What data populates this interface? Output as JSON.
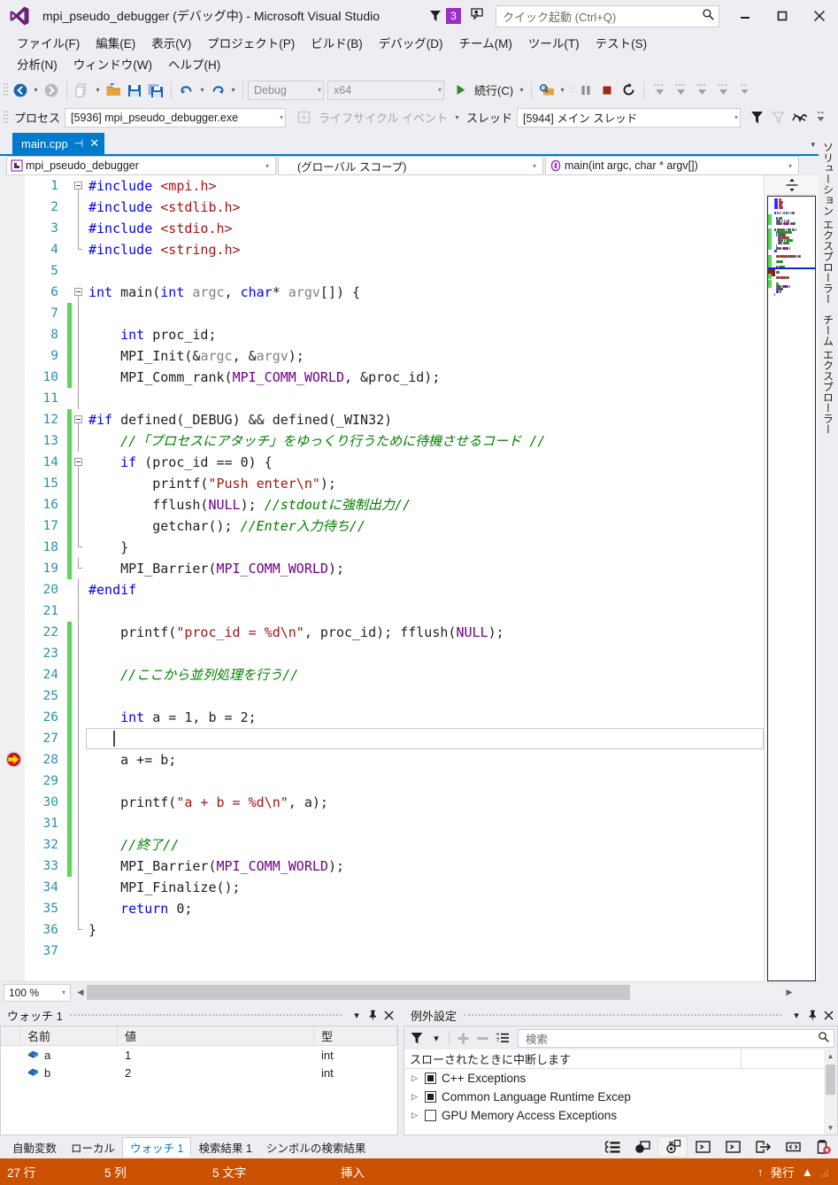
{
  "window": {
    "title": "mpi_pseudo_debugger (デバッグ中) - Microsoft Visual Studio",
    "notification_count": "3",
    "quick_launch_placeholder": "クイック起動 (Ctrl+Q)",
    "minimize_label": "—",
    "maximize_label": "❐",
    "close_label": "✕"
  },
  "menu": {
    "row1": [
      {
        "label": "ファイル(F)"
      },
      {
        "label": "編集(E)"
      },
      {
        "label": "表示(V)"
      },
      {
        "label": "プロジェクト(P)"
      },
      {
        "label": "ビルド(B)"
      },
      {
        "label": "デバッグ(D)"
      },
      {
        "label": "チーム(M)"
      },
      {
        "label": "ツール(T)"
      },
      {
        "label": "テスト(S)"
      }
    ],
    "row2": [
      {
        "label": "分析(N)"
      },
      {
        "label": "ウィンドウ(W)"
      },
      {
        "label": "ヘルプ(H)"
      }
    ]
  },
  "toolbar_standard": {
    "config_value": "Debug",
    "platform_value": "x64",
    "continue_label": "続行(C)"
  },
  "toolbar_debug": {
    "process_label": "プロセス",
    "process_value": "[5936] mpi_pseudo_debugger.exe",
    "lifecycle_label": "ライフサイクル イベント",
    "thread_label": "スレッド",
    "thread_value": "[5944] メイン スレッド"
  },
  "document_tab": {
    "name": "main.cpp",
    "pin_glyph": "⊣",
    "close_glyph": "✕"
  },
  "navbar": {
    "project": "mpi_pseudo_debugger",
    "scope": "(グローバル スコープ)",
    "member": "main(int argc, char * argv[])"
  },
  "editor": {
    "zoom": "100 %",
    "lines": [
      {
        "n": "1",
        "changed": false,
        "outline": "start",
        "tokens": [
          {
            "t": "#include ",
            "c": "pp"
          },
          {
            "t": "<mpi.h>",
            "c": "str"
          }
        ]
      },
      {
        "n": "2",
        "changed": false,
        "outline": "line",
        "tokens": [
          {
            "t": "#include ",
            "c": "pp"
          },
          {
            "t": "<stdlib.h>",
            "c": "str"
          }
        ]
      },
      {
        "n": "3",
        "changed": false,
        "outline": "line",
        "tokens": [
          {
            "t": "#include ",
            "c": "pp"
          },
          {
            "t": "<stdio.h>",
            "c": "str"
          }
        ]
      },
      {
        "n": "4",
        "changed": false,
        "outline": "end",
        "tokens": [
          {
            "t": "#include ",
            "c": "pp"
          },
          {
            "t": "<string.h>",
            "c": "str"
          }
        ]
      },
      {
        "n": "5",
        "changed": false,
        "outline": "",
        "tokens": []
      },
      {
        "n": "6",
        "changed": false,
        "outline": "start",
        "tokens": [
          {
            "t": "int",
            "c": "k"
          },
          {
            "t": " main(",
            "c": "op"
          },
          {
            "t": "int",
            "c": "k"
          },
          {
            "t": " ",
            "c": "op"
          },
          {
            "t": "argc",
            "c": "pa"
          },
          {
            "t": ", ",
            "c": "op"
          },
          {
            "t": "char",
            "c": "k"
          },
          {
            "t": "* ",
            "c": "op"
          },
          {
            "t": "argv",
            "c": "pa"
          },
          {
            "t": "[]) {",
            "c": "op"
          }
        ]
      },
      {
        "n": "7",
        "changed": true,
        "outline": "line",
        "tokens": []
      },
      {
        "n": "8",
        "changed": true,
        "outline": "line",
        "tokens": [
          {
            "t": "    ",
            "c": "op"
          },
          {
            "t": "int",
            "c": "k"
          },
          {
            "t": " proc_id;",
            "c": "op"
          }
        ]
      },
      {
        "n": "9",
        "changed": true,
        "outline": "line",
        "tokens": [
          {
            "t": "    MPI_Init(&",
            "c": "op"
          },
          {
            "t": "argc",
            "c": "pa"
          },
          {
            "t": ", &",
            "c": "op"
          },
          {
            "t": "argv",
            "c": "pa"
          },
          {
            "t": ");",
            "c": "op"
          }
        ]
      },
      {
        "n": "10",
        "changed": true,
        "outline": "line",
        "tokens": [
          {
            "t": "    MPI_Comm_rank(",
            "c": "op"
          },
          {
            "t": "MPI_COMM_WORLD",
            "c": "mac"
          },
          {
            "t": ", &proc_id);",
            "c": "op"
          }
        ]
      },
      {
        "n": "11",
        "changed": false,
        "outline": "line",
        "tokens": []
      },
      {
        "n": "12",
        "changed": true,
        "outline": "start",
        "tokens": [
          {
            "t": "#if",
            "c": "pp"
          },
          {
            "t": " defined(",
            "c": "op"
          },
          {
            "t": "_DEBUG",
            "c": "op"
          },
          {
            "t": ") ",
            "c": "op"
          },
          {
            "t": "&&",
            "c": "op"
          },
          {
            "t": " defined(",
            "c": "op"
          },
          {
            "t": "_WIN32",
            "c": "op"
          },
          {
            "t": ")",
            "c": "op"
          }
        ]
      },
      {
        "n": "13",
        "changed": true,
        "outline": "line",
        "tokens": [
          {
            "t": "    //「プロセスにアタッチ」をゆっくり行うために待機させるコード //",
            "c": "cm"
          }
        ]
      },
      {
        "n": "14",
        "changed": true,
        "outline": "substart",
        "tokens": [
          {
            "t": "    ",
            "c": "op"
          },
          {
            "t": "if",
            "c": "k"
          },
          {
            "t": " (proc_id == 0) {",
            "c": "op"
          }
        ]
      },
      {
        "n": "15",
        "changed": true,
        "outline": "line",
        "tokens": [
          {
            "t": "        printf(",
            "c": "op"
          },
          {
            "t": "\"Push enter\\n\"",
            "c": "str"
          },
          {
            "t": ");",
            "c": "op"
          }
        ]
      },
      {
        "n": "16",
        "changed": true,
        "outline": "line",
        "tokens": [
          {
            "t": "        fflush(",
            "c": "op"
          },
          {
            "t": "NULL",
            "c": "mac"
          },
          {
            "t": "); ",
            "c": "op"
          },
          {
            "t": "//stdoutに強制出力//",
            "c": "cm"
          }
        ]
      },
      {
        "n": "17",
        "changed": true,
        "outline": "line",
        "tokens": [
          {
            "t": "        getchar(); ",
            "c": "op"
          },
          {
            "t": "//Enter入力待ち//",
            "c": "cm"
          }
        ]
      },
      {
        "n": "18",
        "changed": true,
        "outline": "subend",
        "tokens": [
          {
            "t": "    }",
            "c": "op"
          }
        ]
      },
      {
        "n": "19",
        "changed": true,
        "outline": "end",
        "tokens": [
          {
            "t": "    MPI_Barrier(",
            "c": "op"
          },
          {
            "t": "MPI_COMM_WORLD",
            "c": "mac"
          },
          {
            "t": ");",
            "c": "op"
          }
        ]
      },
      {
        "n": "20",
        "changed": false,
        "outline": "line",
        "tokens": [
          {
            "t": "#endif",
            "c": "pp"
          }
        ]
      },
      {
        "n": "21",
        "changed": false,
        "outline": "line",
        "tokens": []
      },
      {
        "n": "22",
        "changed": true,
        "outline": "line",
        "tokens": [
          {
            "t": "    printf(",
            "c": "op"
          },
          {
            "t": "\"proc_id = %d\\n\"",
            "c": "str"
          },
          {
            "t": ", proc_id); fflush(",
            "c": "op"
          },
          {
            "t": "NULL",
            "c": "mac"
          },
          {
            "t": ");",
            "c": "op"
          }
        ]
      },
      {
        "n": "23",
        "changed": true,
        "outline": "line",
        "tokens": []
      },
      {
        "n": "24",
        "changed": true,
        "outline": "line",
        "tokens": [
          {
            "t": "    //ここから並列処理を行う//",
            "c": "cm"
          }
        ]
      },
      {
        "n": "25",
        "changed": true,
        "outline": "line",
        "tokens": []
      },
      {
        "n": "26",
        "changed": true,
        "outline": "line",
        "tokens": [
          {
            "t": "    ",
            "c": "op"
          },
          {
            "t": "int",
            "c": "k"
          },
          {
            "t": " a = 1, b = 2;",
            "c": "op"
          }
        ]
      },
      {
        "n": "27",
        "changed": true,
        "outline": "line",
        "current": true,
        "tokens": []
      },
      {
        "n": "28",
        "changed": true,
        "outline": "line",
        "exec": true,
        "tokens": [
          {
            "t": "    a += b;",
            "c": "op"
          }
        ]
      },
      {
        "n": "29",
        "changed": true,
        "outline": "line",
        "tokens": []
      },
      {
        "n": "30",
        "changed": true,
        "outline": "line",
        "tokens": [
          {
            "t": "    printf(",
            "c": "op"
          },
          {
            "t": "\"a + b = %d\\n\"",
            "c": "str"
          },
          {
            "t": ", a);",
            "c": "op"
          }
        ]
      },
      {
        "n": "31",
        "changed": true,
        "outline": "line",
        "tokens": []
      },
      {
        "n": "32",
        "changed": true,
        "outline": "line",
        "tokens": [
          {
            "t": "    //終了//",
            "c": "cm"
          }
        ]
      },
      {
        "n": "33",
        "changed": true,
        "outline": "line",
        "tokens": [
          {
            "t": "    MPI_Barrier(",
            "c": "op"
          },
          {
            "t": "MPI_COMM_WORLD",
            "c": "mac"
          },
          {
            "t": ");",
            "c": "op"
          }
        ]
      },
      {
        "n": "34",
        "changed": false,
        "outline": "line",
        "tokens": [
          {
            "t": "    MPI_Finalize();",
            "c": "op"
          }
        ]
      },
      {
        "n": "35",
        "changed": false,
        "outline": "line",
        "tokens": [
          {
            "t": "    ",
            "c": "op"
          },
          {
            "t": "return",
            "c": "k"
          },
          {
            "t": " 0;",
            "c": "op"
          }
        ]
      },
      {
        "n": "36",
        "changed": false,
        "outline": "endall",
        "tokens": [
          {
            "t": "}",
            "c": "op"
          }
        ]
      },
      {
        "n": "37",
        "changed": false,
        "outline": "",
        "tokens": []
      }
    ]
  },
  "right_tool_tabs": [
    {
      "label": "ソリューション エクスプローラー"
    },
    {
      "label": "チーム エクスプローラー"
    }
  ],
  "watch_panel": {
    "title": "ウォッチ 1",
    "columns": [
      "名前",
      "値",
      "型"
    ],
    "rows": [
      {
        "name": "a",
        "value": "1",
        "type": "int"
      },
      {
        "name": "b",
        "value": "2",
        "type": "int"
      }
    ]
  },
  "exception_panel": {
    "title": "例外設定",
    "search_placeholder": "検索",
    "column_header": "スローされたときに中断します",
    "rows": [
      {
        "label": "C++ Exceptions",
        "checked": true
      },
      {
        "label": "Common Language Runtime Excep",
        "checked": true
      },
      {
        "label": "GPU Memory Access Exceptions",
        "checked": false
      }
    ]
  },
  "bottom_tabs": [
    {
      "label": "自動変数",
      "active": false
    },
    {
      "label": "ローカル",
      "active": false
    },
    {
      "label": "ウォッチ 1",
      "active": true
    },
    {
      "label": "検索結果 1",
      "active": false
    },
    {
      "label": "シンボルの検索結果",
      "active": false
    }
  ],
  "statusbar": {
    "line": "27 行",
    "column": "5 列",
    "chars": "5 文字",
    "mode": "挿入",
    "publish": "発行",
    "publish_arrow": "▲",
    "up_arrow": "↑"
  },
  "colors": {
    "accent": "#007acc",
    "debug_status": "#ca5100",
    "badge": "#9b30c4",
    "changed_bar": "#57d957",
    "keyword": "#0000ff",
    "string": "#a31515",
    "comment": "#008000",
    "macro": "#6f008a",
    "linenumber": "#2b91af"
  }
}
